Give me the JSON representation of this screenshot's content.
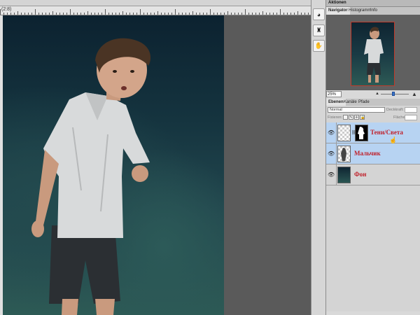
{
  "document": {
    "tab_label": "(2:8)"
  },
  "panels": {
    "actions_title": "Aktionen",
    "navigator_tabs": [
      {
        "label": "Navigator",
        "active": true
      },
      {
        "label": "Histogramm",
        "active": false
      },
      {
        "label": "Info",
        "active": false
      }
    ],
    "zoom_value": "25%",
    "zoom_level": 0.45,
    "layers_tabs": [
      {
        "label": "Ebenen",
        "active": true
      },
      {
        "label": "Kanäle",
        "active": false
      },
      {
        "label": "Pfade",
        "active": false
      }
    ],
    "blend_mode": "Normal",
    "opacity_label": "Deckkraft:",
    "lock_label": "Fixieren:",
    "fill_label": "Fläche:",
    "layers": [
      {
        "name": "Тени/Света",
        "selected": true,
        "has_mask": true
      },
      {
        "name": "Мальчик",
        "selected": true,
        "has_mask": false
      },
      {
        "name": "Фон",
        "selected": false,
        "has_mask": false
      }
    ]
  },
  "icons": {
    "tool_1": "palette-icon",
    "tool_2": "puppet-icon",
    "tool_3": "hand-icon",
    "cursor": "hand-pointer-icon"
  },
  "colors": {
    "layer_name": "#c0202a",
    "selection": "#b7d3f2",
    "zoom_knob": "#3a72c9"
  }
}
